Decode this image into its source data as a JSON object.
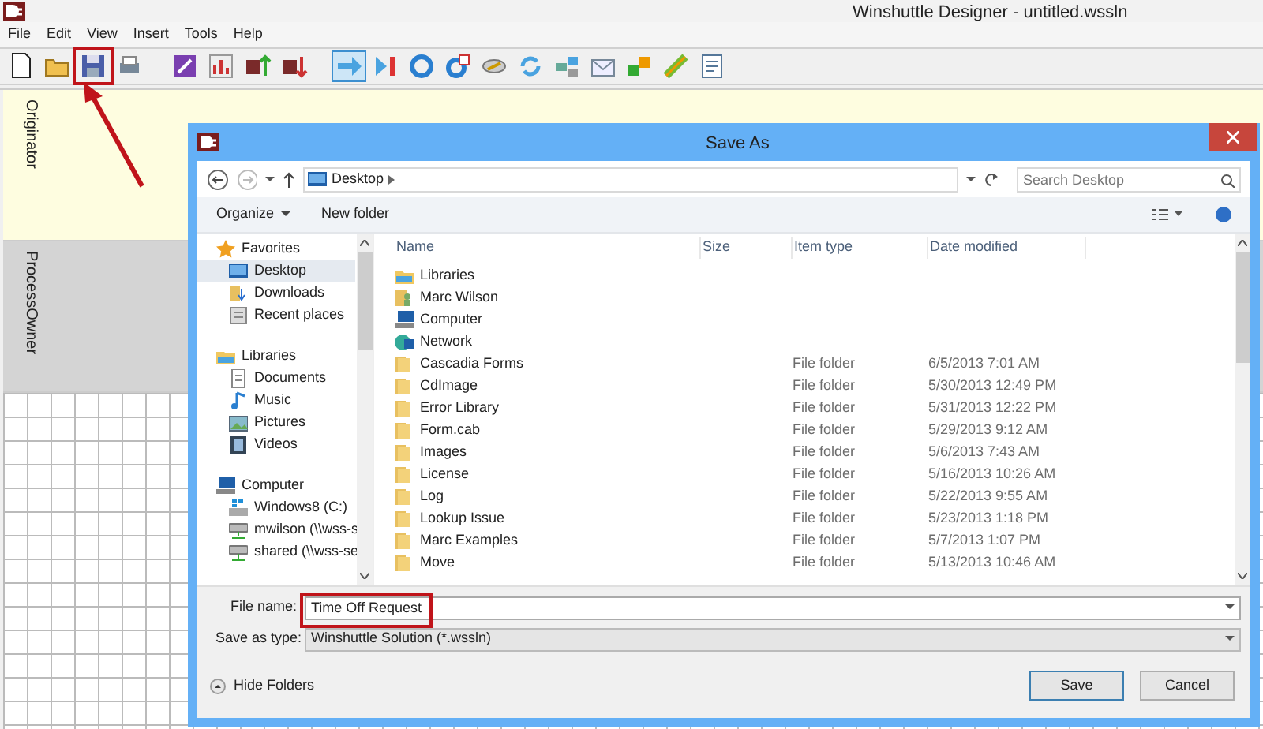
{
  "window": {
    "title": "Winshuttle Designer - untitled.wssln"
  },
  "menu": [
    "File",
    "Edit",
    "View",
    "Insert",
    "Tools",
    "Help"
  ],
  "toolbar": [
    {
      "selected": false
    },
    {
      "selected": false
    },
    {
      "selected": false,
      "highlighted": true
    },
    {
      "selected": false
    },
    {
      "selected": false
    },
    {
      "selected": false
    },
    {
      "selected": false
    },
    {
      "selected": false
    },
    {
      "selected": true
    },
    {
      "selected": false
    },
    {
      "selected": false
    },
    {
      "selected": false
    },
    {
      "selected": false
    },
    {
      "selected": false
    },
    {
      "selected": false
    },
    {
      "selected": false
    },
    {
      "selected": false
    },
    {
      "selected": false
    },
    {
      "selected": false
    }
  ],
  "lanes": [
    {
      "label": "Originator",
      "color": "#fefde0"
    },
    {
      "label": "ProcessOwner",
      "color": "#d4d4d4"
    }
  ],
  "dialog": {
    "title": "Save As",
    "path": "Desktop",
    "search": {
      "placeholder": "Search Desktop"
    },
    "commands": [
      "Organize",
      "New folder"
    ],
    "nav": [
      {
        "label": "Favorites",
        "kind": "star",
        "children": [
          {
            "label": "Desktop",
            "kind": "desktop",
            "selected": true
          },
          {
            "label": "Downloads",
            "kind": "download",
            "selected": false
          },
          {
            "label": "Recent places",
            "kind": "recent",
            "selected": false
          }
        ]
      },
      {
        "label": "Libraries",
        "kind": "library",
        "children": [
          {
            "label": "Documents",
            "kind": "document",
            "selected": false
          },
          {
            "label": "Music",
            "kind": "music",
            "selected": false
          },
          {
            "label": "Pictures",
            "kind": "picture",
            "selected": false
          },
          {
            "label": "Videos",
            "kind": "video",
            "selected": false
          }
        ]
      },
      {
        "label": "Computer",
        "kind": "computer",
        "children": [
          {
            "label": "Windows8 (C:)",
            "kind": "drive",
            "selected": false
          },
          {
            "label": "mwilson (\\\\wss-s",
            "kind": "netdrive",
            "selected": false
          },
          {
            "label": "shared (\\\\wss-se",
            "kind": "netdrive",
            "selected": false
          }
        ]
      }
    ],
    "columns": [
      "Name",
      "Size",
      "Item type",
      "Date modified"
    ],
    "files": [
      {
        "name": "Libraries",
        "kind": "library"
      },
      {
        "name": "Marc Wilson",
        "kind": "user"
      },
      {
        "name": "Computer",
        "kind": "computer"
      },
      {
        "name": "Network",
        "kind": "network"
      },
      {
        "name": "Cascadia Forms",
        "kind": "folder",
        "type": "File folder",
        "date": "6/5/2013 7:01 AM"
      },
      {
        "name": "CdImage",
        "kind": "folder",
        "type": "File folder",
        "date": "5/30/2013 12:49 PM"
      },
      {
        "name": "Error Library",
        "kind": "folder",
        "type": "File folder",
        "date": "5/31/2013 12:22 PM"
      },
      {
        "name": "Form.cab",
        "kind": "folder",
        "type": "File folder",
        "date": "5/29/2013 9:12 AM"
      },
      {
        "name": "Images",
        "kind": "folder",
        "type": "File folder",
        "date": "5/6/2013 7:43 AM"
      },
      {
        "name": "License",
        "kind": "folder",
        "type": "File folder",
        "date": "5/16/2013 10:26 AM"
      },
      {
        "name": "Log",
        "kind": "folder",
        "type": "File folder",
        "date": "5/22/2013 9:55 AM"
      },
      {
        "name": "Lookup Issue",
        "kind": "folder",
        "type": "File folder",
        "date": "5/23/2013 1:18 PM"
      },
      {
        "name": "Marc Examples",
        "kind": "folder",
        "type": "File folder",
        "date": "5/7/2013 1:07 PM"
      },
      {
        "name": "Move",
        "kind": "folder",
        "type": "File folder",
        "date": "5/13/2013 10:46 AM"
      }
    ],
    "file_name": {
      "label": "File name:",
      "value": "Time Off Request",
      "highlighted": true
    },
    "save_type": {
      "label": "Save as type:",
      "value": "Winshuttle Solution (*.wssln)"
    },
    "hide_folders": "Hide Folders",
    "buttons": [
      "Save",
      "Cancel"
    ]
  }
}
